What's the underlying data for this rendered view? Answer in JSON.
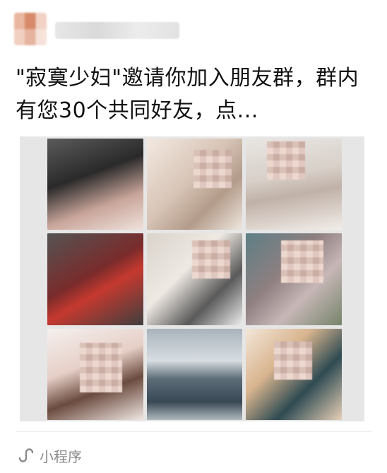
{
  "post": {
    "title": "\"寂寞少妇\"邀请你加入朋友群，群内有您30个共同好友，点..."
  },
  "images": [
    {
      "name": "grid-image-1"
    },
    {
      "name": "grid-image-2"
    },
    {
      "name": "grid-image-3"
    },
    {
      "name": "grid-image-4"
    },
    {
      "name": "grid-image-5"
    },
    {
      "name": "grid-image-6"
    },
    {
      "name": "grid-image-7"
    },
    {
      "name": "grid-image-8"
    },
    {
      "name": "grid-image-9"
    }
  ],
  "footer": {
    "label": "小程序",
    "icon": "mini-program-icon"
  },
  "colors": {
    "text": "#111111",
    "muted": "#8a8a8a",
    "grid_bg": "#e6e6e6"
  }
}
